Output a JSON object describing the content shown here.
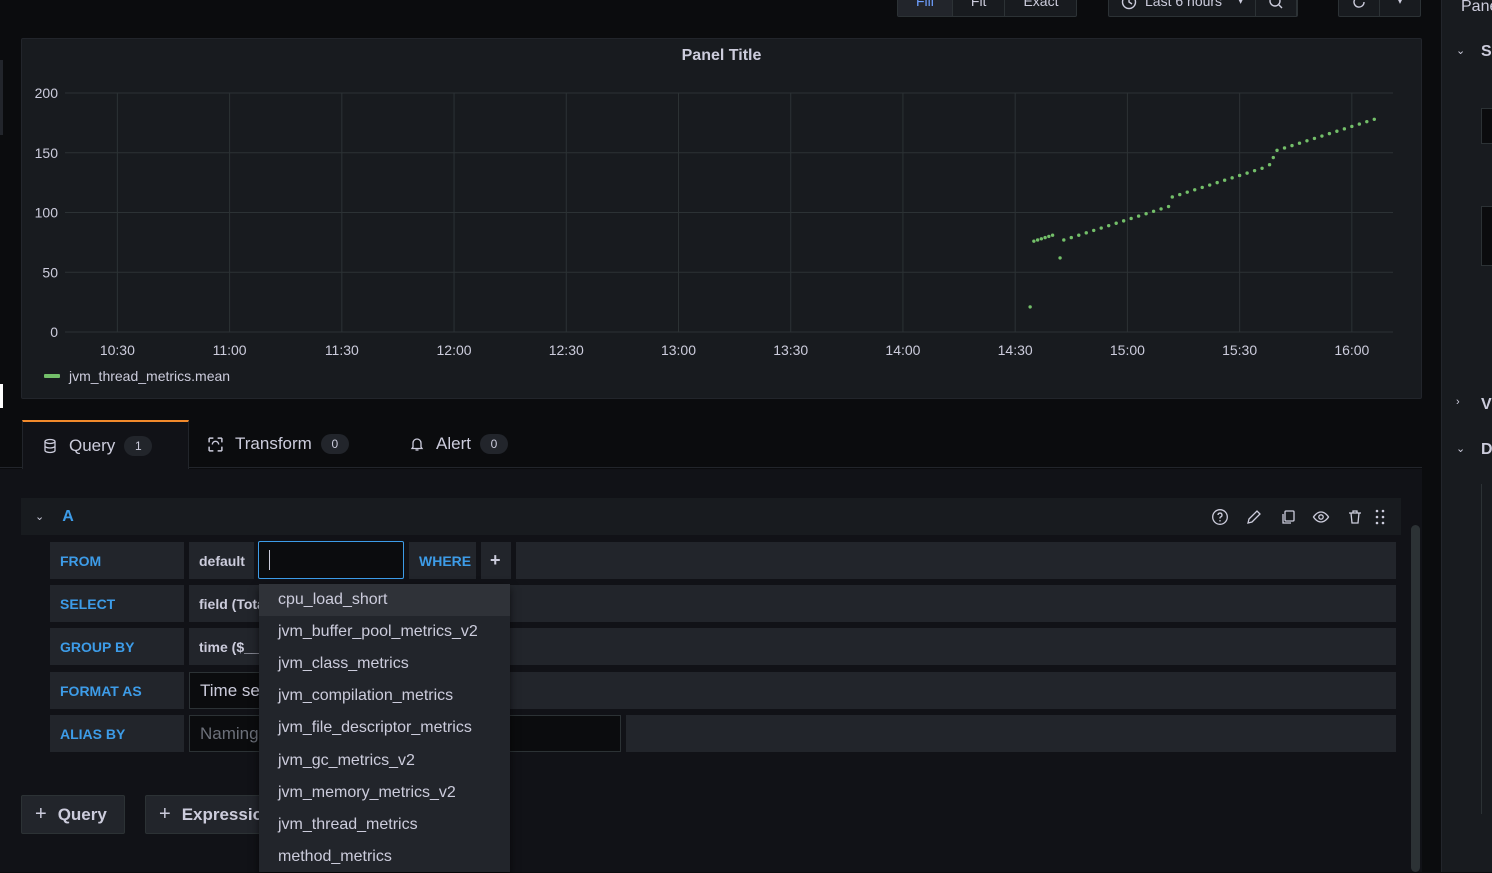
{
  "toolbar": {
    "display_modes": [
      "Fill",
      "Fit",
      "Exact"
    ],
    "active_mode": "Fill",
    "time_range": "Last 6 hours"
  },
  "panel": {
    "title": "Panel Title",
    "legend": "jvm_thread_metrics.mean"
  },
  "chart_data": {
    "type": "scatter",
    "title": "Panel Title",
    "xlabel": "",
    "ylabel": "",
    "x_ticks": [
      "10:30",
      "11:00",
      "11:30",
      "12:00",
      "12:30",
      "13:00",
      "13:30",
      "14:00",
      "14:30",
      "15:00",
      "15:30",
      "16:00"
    ],
    "y_ticks": [
      0,
      50,
      100,
      150,
      200
    ],
    "ylim": [
      0,
      200
    ],
    "xlim_minutes": [
      "10:30",
      "16:07"
    ],
    "grid": true,
    "legend_position": "bottom-left",
    "series": [
      {
        "name": "jvm_thread_metrics.mean",
        "color": "#73bf69",
        "points": [
          [
            "14:34",
            21
          ],
          [
            "14:35",
            76
          ],
          [
            "14:36",
            77
          ],
          [
            "14:37",
            78
          ],
          [
            "14:38",
            79
          ],
          [
            "14:39",
            80
          ],
          [
            "14:40",
            81
          ],
          [
            "14:42",
            62
          ],
          [
            "14:43",
            77
          ],
          [
            "14:45",
            79
          ],
          [
            "14:47",
            81
          ],
          [
            "14:49",
            83
          ],
          [
            "14:51",
            85
          ],
          [
            "14:53",
            87
          ],
          [
            "14:55",
            89
          ],
          [
            "14:57",
            91
          ],
          [
            "14:59",
            93
          ],
          [
            "15:01",
            95
          ],
          [
            "15:03",
            97
          ],
          [
            "15:05",
            99
          ],
          [
            "15:07",
            101
          ],
          [
            "15:09",
            103
          ],
          [
            "15:11",
            105
          ],
          [
            "15:12",
            113
          ],
          [
            "15:14",
            115
          ],
          [
            "15:16",
            117
          ],
          [
            "15:18",
            119
          ],
          [
            "15:20",
            121
          ],
          [
            "15:22",
            123
          ],
          [
            "15:24",
            125
          ],
          [
            "15:26",
            127
          ],
          [
            "15:28",
            129
          ],
          [
            "15:30",
            131
          ],
          [
            "15:32",
            133
          ],
          [
            "15:34",
            135
          ],
          [
            "15:36",
            137
          ],
          [
            "15:38",
            140
          ],
          [
            "15:39",
            146
          ],
          [
            "15:40",
            152
          ],
          [
            "15:42",
            154
          ],
          [
            "15:44",
            156
          ],
          [
            "15:46",
            158
          ],
          [
            "15:48",
            160
          ],
          [
            "15:50",
            162
          ],
          [
            "15:52",
            164
          ],
          [
            "15:54",
            166
          ],
          [
            "15:56",
            168
          ],
          [
            "15:58",
            170
          ],
          [
            "16:00",
            172
          ],
          [
            "16:02",
            174
          ],
          [
            "16:04",
            176
          ],
          [
            "16:06",
            178
          ]
        ]
      }
    ]
  },
  "tabs": [
    {
      "label": "Query",
      "count": "1"
    },
    {
      "label": "Transform",
      "count": "0"
    },
    {
      "label": "Alert",
      "count": "0"
    }
  ],
  "query": {
    "ref_id": "A",
    "from_label": "FROM",
    "from_policy": "default",
    "measurement_value": "",
    "where_label": "WHERE",
    "plus": "+",
    "select_label": "SELECT",
    "select_value": "field (Tota",
    "group_by_label": "GROUP BY",
    "group_by_value": "time ($__",
    "format_as_label": "FORMAT AS",
    "format_as_value": "Time se",
    "alias_by_label": "ALIAS BY",
    "alias_placeholder": "Naming"
  },
  "measurement_dropdown": [
    "cpu_load_short",
    "jvm_buffer_pool_metrics_v2",
    "jvm_class_metrics",
    "jvm_compilation_metrics",
    "jvm_file_descriptor_metrics",
    "jvm_gc_metrics_v2",
    "jvm_memory_metrics_v2",
    "jvm_thread_metrics",
    "method_metrics"
  ],
  "buttons": {
    "add_query": "Query",
    "add_expression": "Expressio"
  },
  "right_pane": {
    "title": "Pane",
    "section_s": "S",
    "section_v": "V",
    "section_d": "D"
  }
}
